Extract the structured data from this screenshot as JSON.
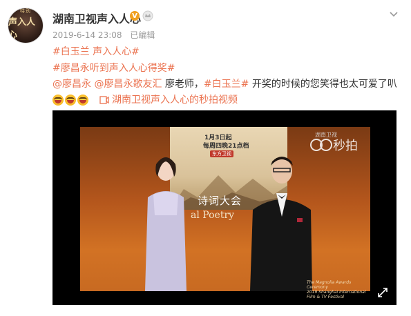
{
  "post": {
    "username": "湖南卫视声入人心",
    "verified_badge": "V",
    "timestamp": "2019-6-14 23:08",
    "edited": "已编辑",
    "avatar_text_top": "特别",
    "avatar_text_main": "声入人心",
    "line1": "#白玉兰 声入人心#",
    "line2": "#廖昌永听到声入人心得奖#",
    "mention1": "@廖昌永",
    "mention2": "@廖昌永歌友汇",
    "body_plain1": "廖老师，",
    "hashtag_inline": "#白玉兰#",
    "body_plain2": "开奖的时候的您笑得也太可爱了叭",
    "video_link_label": "湖南卫视声入人心的秒拍视频"
  },
  "video": {
    "poster_date": "1月3日起",
    "poster_time": "每周四晚21点档",
    "poster_logo": "东方卫视",
    "stage_text_cn": "诗词大会",
    "stage_text_en": "al Poetry",
    "watermark": "秒拍",
    "watermark_small": "湖南卫视",
    "caption_line1": "The Magnolia Awards Ceremony",
    "caption_line2": "2019 Shanghai International Film & TV Festival"
  },
  "colors": {
    "link": "#eb7350",
    "badge": "#f0a020"
  },
  "icons": [
    "verified-icon",
    "crown-icon",
    "chevron-down-icon",
    "emoji-laugh-icon",
    "video-link-icon",
    "fullscreen-icon"
  ]
}
